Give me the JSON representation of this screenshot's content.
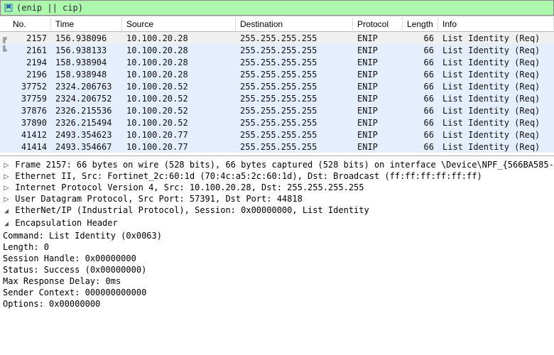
{
  "filter": {
    "value": "(enip || cip)"
  },
  "columns": {
    "no": "No.",
    "time": "Time",
    "source": "Source",
    "destination": "Destination",
    "protocol": "Protocol",
    "length": "Length",
    "info": "Info"
  },
  "packets": [
    {
      "no": "2157",
      "time": "156.938096",
      "source": "10.100.20.28",
      "dest": "255.255.255.255",
      "proto": "ENIP",
      "length": "66",
      "info": "List Identity (Req)",
      "selected": true,
      "bracket": "╔"
    },
    {
      "no": "2161",
      "time": "156.938133",
      "source": "10.100.20.28",
      "dest": "255.255.255.255",
      "proto": "ENIP",
      "length": "66",
      "info": "List Identity (Req)",
      "selected": false,
      "bracket": "╚"
    },
    {
      "no": "2194",
      "time": "158.938904",
      "source": "10.100.20.28",
      "dest": "255.255.255.255",
      "proto": "ENIP",
      "length": "66",
      "info": "List Identity (Req)",
      "selected": false,
      "bracket": ""
    },
    {
      "no": "2196",
      "time": "158.938948",
      "source": "10.100.20.28",
      "dest": "255.255.255.255",
      "proto": "ENIP",
      "length": "66",
      "info": "List Identity (Req)",
      "selected": false,
      "bracket": ""
    },
    {
      "no": "37752",
      "time": "2324.206763",
      "source": "10.100.20.52",
      "dest": "255.255.255.255",
      "proto": "ENIP",
      "length": "66",
      "info": "List Identity (Req)",
      "selected": false,
      "bracket": ""
    },
    {
      "no": "37759",
      "time": "2324.206752",
      "source": "10.100.20.52",
      "dest": "255.255.255.255",
      "proto": "ENIP",
      "length": "66",
      "info": "List Identity (Req)",
      "selected": false,
      "bracket": ""
    },
    {
      "no": "37876",
      "time": "2326.215536",
      "source": "10.100.20.52",
      "dest": "255.255.255.255",
      "proto": "ENIP",
      "length": "66",
      "info": "List Identity (Req)",
      "selected": false,
      "bracket": ""
    },
    {
      "no": "37890",
      "time": "2326.215494",
      "source": "10.100.20.52",
      "dest": "255.255.255.255",
      "proto": "ENIP",
      "length": "66",
      "info": "List Identity (Req)",
      "selected": false,
      "bracket": ""
    },
    {
      "no": "41412",
      "time": "2493.354623",
      "source": "10.100.20.77",
      "dest": "255.255.255.255",
      "proto": "ENIP",
      "length": "66",
      "info": "List Identity (Req)",
      "selected": false,
      "bracket": ""
    },
    {
      "no": "41414",
      "time": "2493.354667",
      "source": "10.100.20.77",
      "dest": "255.255.255.255",
      "proto": "ENIP",
      "length": "66",
      "info": "List Identity (Req)",
      "selected": false,
      "bracket": ""
    }
  ],
  "details": {
    "frame": "Frame 2157: 66 bytes on wire (528 bits), 66 bytes captured (528 bits) on interface \\Device\\NPF_{566BA585-",
    "eth": "Ethernet II, Src: Fortinet_2c:60:1d (70:4c:a5:2c:60:1d), Dst: Broadcast (ff:ff:ff:ff:ff:ff)",
    "ip": "Internet Protocol Version 4, Src: 10.100.20.28, Dst: 255.255.255.255",
    "udp": "User Datagram Protocol, Src Port: 57391, Dst Port: 44818",
    "enip": "EtherNet/IP (Industrial Protocol), Session: 0x00000000, List Identity",
    "encap_hdr": "Encapsulation Header",
    "fields": {
      "command": "Command: List Identity (0x0063)",
      "length": "Length: 0",
      "session_handle": "Session Handle: 0x00000000",
      "status": "Status: Success (0x00000000)",
      "max_delay": "Max Response Delay: 0ms",
      "sender_ctx": "Sender Context: 000000000000",
      "options": "Options: 0x00000000"
    }
  }
}
